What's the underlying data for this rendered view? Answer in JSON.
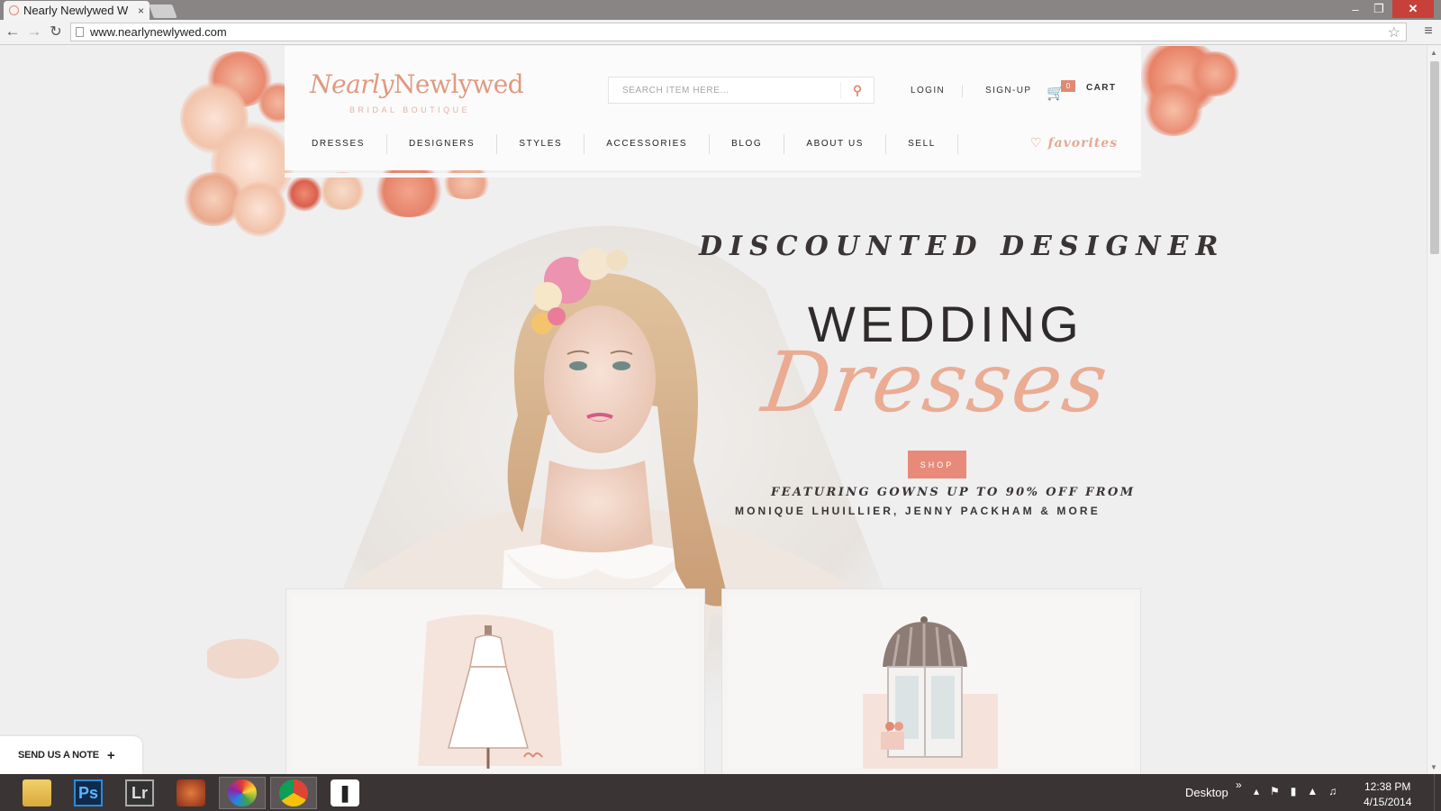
{
  "browser": {
    "tab_title": "Nearly Newlywed W",
    "tab_close": "×",
    "url": "www.nearlynewlywed.com",
    "window_controls": {
      "minimize": "–",
      "maximize": "❐",
      "close": "✕"
    },
    "nav": {
      "back": "←",
      "forward": "→",
      "reload": "↻",
      "star": "☆",
      "menu": "≡"
    }
  },
  "site": {
    "logo": {
      "script": "Nearly",
      "serif": "Newlywed",
      "tagline": "BRIDAL BOUTIQUE"
    },
    "search": {
      "placeholder": "SEARCH ITEM HERE..."
    },
    "header_links": {
      "login": "LOGIN",
      "signup": "SIGN-UP",
      "cart": "CART",
      "cart_count": "0"
    },
    "nav_items": [
      "DRESSES",
      "DESIGNERS",
      "STYLES",
      "ACCESSORIES",
      "BLOG",
      "ABOUT US",
      "SELL"
    ],
    "favorites": "favorites",
    "hero": {
      "line1": "DISCOUNTED DESIGNER",
      "line2": "WEDDING",
      "line3": "Dresses",
      "shop_button": "SHOP",
      "sub1": "FEATURING GOWNS UP TO 90% OFF FROM",
      "sub2": "MONIQUE LHUILLIER, JENNY PACKHAM & MORE"
    },
    "note_widget": {
      "label": "SEND US A NOTE",
      "plus": "+"
    }
  },
  "taskbar": {
    "apps": [
      {
        "name": "file-explorer",
        "label": ""
      },
      {
        "name": "photoshop",
        "label": "Ps"
      },
      {
        "name": "lightroom",
        "label": "Lr"
      },
      {
        "name": "app-red",
        "label": ""
      },
      {
        "name": "picasa",
        "label": ""
      },
      {
        "name": "chrome",
        "label": ""
      },
      {
        "name": "app-white",
        "label": ""
      }
    ],
    "desktop_label": "Desktop",
    "desktop_chevron": "»",
    "time": "12:38 PM",
    "date": "4/15/2014"
  },
  "colors": {
    "accent": "#e88a79",
    "logo": "#e09a80",
    "text_dark": "#3a3434",
    "close_red": "#c7403a"
  }
}
